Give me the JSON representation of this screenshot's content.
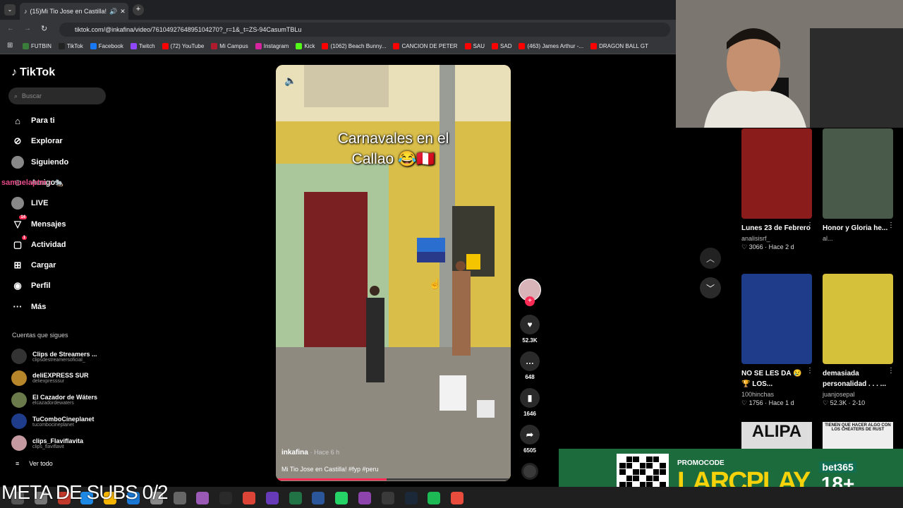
{
  "browser": {
    "tab_title": "(15)Mi Tio Jose en Castilla!",
    "url": "tiktok.com/@inkafina/video/7610492764895104270?_r=1&_t=ZS-94CasumTBLu",
    "bookmarks": [
      {
        "label": "FUTBIN",
        "color": "#3a7d3a"
      },
      {
        "label": "TikTok",
        "color": "#222222"
      },
      {
        "label": "Facebook",
        "color": "#1877f2"
      },
      {
        "label": "Twitch",
        "color": "#9146ff"
      },
      {
        "label": "(72) YouTube",
        "color": "#ff0000"
      },
      {
        "label": "Mi Campus",
        "color": "#b01c2e"
      },
      {
        "label": "Instagram",
        "color": "#d6249f"
      },
      {
        "label": "Kick",
        "color": "#53fc18"
      },
      {
        "label": "(1062) Beach Bunny...",
        "color": "#ff0000"
      },
      {
        "label": "CANCION DE PETER",
        "color": "#ff0000"
      },
      {
        "label": "SAU",
        "color": "#ff0000"
      },
      {
        "label": "SAD",
        "color": "#ff0000"
      },
      {
        "label": "(463) James Arthur -...",
        "color": "#ff0000"
      },
      {
        "label": "DRAGON BALL GT",
        "color": "#ff0000"
      }
    ]
  },
  "sidebar": {
    "logo": "TikTok",
    "search_placeholder": "Buscar",
    "nav": [
      {
        "label": "Para ti",
        "icon": "home-icon",
        "glyph": "⌂"
      },
      {
        "label": "Explorar",
        "icon": "compass-icon",
        "glyph": "⊘"
      },
      {
        "label": "Siguiendo",
        "icon": "following-avatar-icon",
        "glyph": "●"
      },
      {
        "label": "Amigos",
        "icon": "friends-icon",
        "glyph": "☺"
      },
      {
        "label": "LIVE",
        "icon": "live-avatar-icon",
        "glyph": "●"
      },
      {
        "label": "Mensajes",
        "icon": "messages-icon",
        "glyph": "▽",
        "badge": "14"
      },
      {
        "label": "Actividad",
        "icon": "activity-icon",
        "glyph": "▢",
        "badge": "1"
      },
      {
        "label": "Cargar",
        "icon": "upload-icon",
        "glyph": "⊞"
      },
      {
        "label": "Perfil",
        "icon": "profile-icon",
        "glyph": "◉"
      },
      {
        "label": "Más",
        "icon": "more-icon",
        "glyph": "···"
      }
    ],
    "overlay_username": "samuelaptm",
    "following_header": "Cuentas que sigues",
    "following": [
      {
        "name": "Clips de Streamers ...",
        "id": "clipsdestreamersoficial_",
        "color": "#333333"
      },
      {
        "name": "deliEXPRESS SUR",
        "id": "deliexpresssur",
        "color": "#b8862a"
      },
      {
        "name": "El Cazador de Wáters",
        "id": "elcazadordewaters",
        "color": "#6a7a4a"
      },
      {
        "name": "TuComboCineplanet",
        "id": "tucombocineplanet",
        "color": "#1e3c8a"
      },
      {
        "name": "clips_Flaviflavita",
        "id": "clips_flaviflavit",
        "color": "#c49aa0"
      }
    ],
    "see_all": "Ver todo"
  },
  "video": {
    "caption_line1": "Carnavales en el",
    "caption_line2": "Callao 😂🇵🇪",
    "author": "inkafina",
    "time": "· Hace 6 h",
    "description": "Mi Tio Jose en Castilla! #fyp #peru",
    "progress": 0.47
  },
  "actions": [
    {
      "icon": "heart-icon",
      "glyph": "♥",
      "count": "52.3K"
    },
    {
      "icon": "comment-icon",
      "glyph": "…",
      "count": "648"
    },
    {
      "icon": "bookmark-icon",
      "glyph": "▮",
      "count": "1646"
    },
    {
      "icon": "share-icon",
      "glyph": "➦",
      "count": "6505"
    }
  ],
  "grid": [
    {
      "title": "Lunes 23 de Febrero",
      "author": "analisisrf_",
      "stats": "♡ 3066 · Hace 2 d",
      "color": "#8a1c1c"
    },
    {
      "title": "Honor y Gloria he...",
      "author": "al...",
      "stats": "",
      "color": "#4a5a4a"
    },
    {
      "title": "NO SE LES DA 😢 🏆 LOS...",
      "author": "100hinchas",
      "stats": "♡ 1756 · Hace 1 d",
      "color": "#1e3c8a"
    },
    {
      "title": "demasiada personalidad . . . ...",
      "author": "juanjosepal",
      "stats": "♡ 52.3K · 2-10",
      "color": "#d6c23a"
    }
  ],
  "grid_bottom": [
    "ALIPA",
    "TIENEN QUE HACER ALGO CON LOS CHEATERS DE RUST"
  ],
  "ad": {
    "promo_label": "PROMOCODE",
    "promo_code": "LARCPLAY",
    "brand": "bet365",
    "age": "18+"
  },
  "stream_overlay": "META DE SUBS 0/2"
}
